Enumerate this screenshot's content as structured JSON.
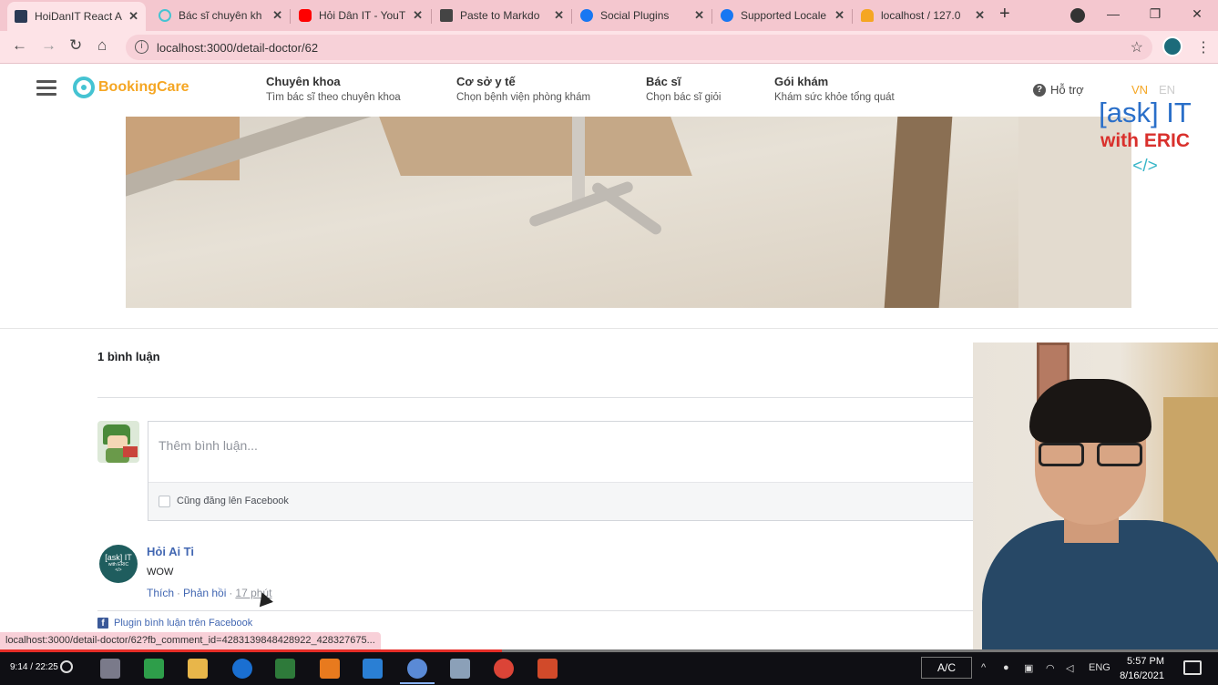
{
  "browser": {
    "tabs": [
      {
        "title": "HoiDanIT React A",
        "color": "#1877f2",
        "active": true
      },
      {
        "title": "Bác sĩ chuyên kh",
        "color": "#45c3d2",
        "active": false
      },
      {
        "title": "Hỏi Dân IT - YouT",
        "color": "#ff0000",
        "active": false
      },
      {
        "title": "Paste to Markdo",
        "color": "#333333",
        "active": false
      },
      {
        "title": "Social Plugins",
        "color": "#1877f2",
        "active": false
      },
      {
        "title": "Supported Locale",
        "color": "#1877f2",
        "active": false
      },
      {
        "title": "localhost / 127.0",
        "color": "#f5a623",
        "active": false
      }
    ],
    "url": "localhost:3000/detail-doctor/62",
    "status_url": "localhost:3000/detail-doctor/62?fb_comment_id=4283139848428922_428327675..."
  },
  "site": {
    "logo": "BookingCare",
    "nav": [
      {
        "title": "Chuyên khoa",
        "sub": "Tìm bác sĩ theo chuyên khoa"
      },
      {
        "title": "Cơ sở y tế",
        "sub": "Chọn bệnh viện phòng khám"
      },
      {
        "title": "Bác sĩ",
        "sub": "Chọn bác sĩ giỏi"
      },
      {
        "title": "Gói khám",
        "sub": "Khám sức khỏe tổng quát"
      }
    ],
    "support": "Hỗ trợ",
    "lang_vn": "VN",
    "lang_en": "EN",
    "lang_vn_color": "#f5a623",
    "lang_en_color": "#cccccc"
  },
  "watermark": {
    "line1": "[ask] IT",
    "line2": "with ERIC",
    "line3": "</>"
  },
  "comments": {
    "count": "1 bình luận",
    "placeholder": "Thêm bình luận...",
    "share_label": "Cũng đăng lên Facebook",
    "items": [
      {
        "author": "Hỏi Ai Ti",
        "avatar_l1": "[ask] IT",
        "avatar_l2": "with ERIC",
        "avatar_l3": "</>",
        "text": "WOW",
        "like": "Thích",
        "reply": "Phản hồi",
        "time": "17 phút"
      }
    ],
    "plugin_label": "Plugin bình luận trên Facebook"
  },
  "video": {
    "elapsed": "9:14",
    "duration": "22:25",
    "progress_fraction": 0.412
  },
  "taskbar": {
    "ac_label": "A/C",
    "lang": "ENG",
    "time": "5:57 PM",
    "date": "8/16/2021"
  }
}
